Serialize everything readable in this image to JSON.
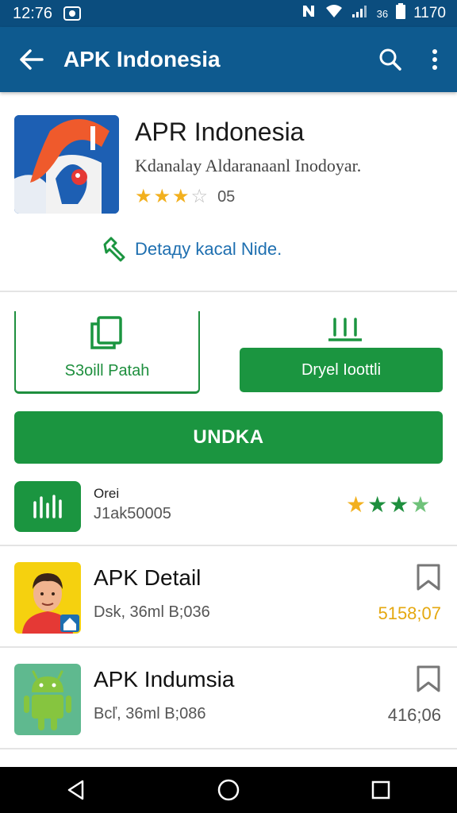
{
  "status_bar": {
    "time": "12:76",
    "signal_text": "36",
    "battery_text": "1170"
  },
  "appbar": {
    "title": "APK Indonesia"
  },
  "app": {
    "name": "APR Indonesia",
    "developer": "Kdanalay Aldaranaanl Inodoyar.",
    "rating_stars": 3,
    "rating_max": 5,
    "rating_count": "05",
    "dev_link": "Detaдy kacal Nide."
  },
  "actions": {
    "outline_button_label": "S3oill Patah",
    "solid_button_label": "Dryel Ioottli",
    "install_button_label": "UNDKA"
  },
  "info_row": {
    "title": "Orei",
    "subtitle": "J1ak50005",
    "stars": 4
  },
  "list": [
    {
      "title": "APK Detail",
      "subtitle": "Dsk, 36ml B;036",
      "meta": "5158;07",
      "meta_color": "#e5a810"
    },
    {
      "title": "APK Indumsia",
      "subtitle": "Bcľ, 36ml B;086",
      "meta": "416;06",
      "meta_color": "#555555"
    }
  ],
  "colors": {
    "appbar": "#0e5a8f",
    "status_bar": "#0b4d7e",
    "accent_green": "#1b9540",
    "link_blue": "#1e6fb0",
    "star_gold": "#f2b01e"
  },
  "icons": {
    "back": "arrow-left-icon",
    "search": "search-icon",
    "more": "more-vert-icon",
    "dev_link": "hammer-icon",
    "outline_button": "copy-icon",
    "solid_button": "download-tray-icon",
    "info": "equalizer-icon",
    "bookmark": "bookmark-icon"
  }
}
